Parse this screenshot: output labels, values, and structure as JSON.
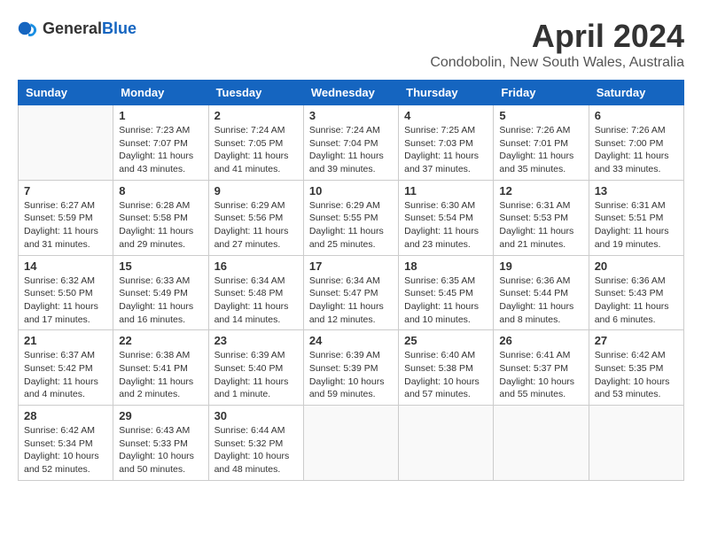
{
  "logo": {
    "text_general": "General",
    "text_blue": "Blue"
  },
  "title": "April 2024",
  "subtitle": "Condobolin, New South Wales, Australia",
  "days_of_week": [
    "Sunday",
    "Monday",
    "Tuesday",
    "Wednesday",
    "Thursday",
    "Friday",
    "Saturday"
  ],
  "weeks": [
    [
      {
        "day": "",
        "info": ""
      },
      {
        "day": "1",
        "info": "Sunrise: 7:23 AM\nSunset: 7:07 PM\nDaylight: 11 hours\nand 43 minutes."
      },
      {
        "day": "2",
        "info": "Sunrise: 7:24 AM\nSunset: 7:05 PM\nDaylight: 11 hours\nand 41 minutes."
      },
      {
        "day": "3",
        "info": "Sunrise: 7:24 AM\nSunset: 7:04 PM\nDaylight: 11 hours\nand 39 minutes."
      },
      {
        "day": "4",
        "info": "Sunrise: 7:25 AM\nSunset: 7:03 PM\nDaylight: 11 hours\nand 37 minutes."
      },
      {
        "day": "5",
        "info": "Sunrise: 7:26 AM\nSunset: 7:01 PM\nDaylight: 11 hours\nand 35 minutes."
      },
      {
        "day": "6",
        "info": "Sunrise: 7:26 AM\nSunset: 7:00 PM\nDaylight: 11 hours\nand 33 minutes."
      }
    ],
    [
      {
        "day": "7",
        "info": "Sunrise: 6:27 AM\nSunset: 5:59 PM\nDaylight: 11 hours\nand 31 minutes."
      },
      {
        "day": "8",
        "info": "Sunrise: 6:28 AM\nSunset: 5:58 PM\nDaylight: 11 hours\nand 29 minutes."
      },
      {
        "day": "9",
        "info": "Sunrise: 6:29 AM\nSunset: 5:56 PM\nDaylight: 11 hours\nand 27 minutes."
      },
      {
        "day": "10",
        "info": "Sunrise: 6:29 AM\nSunset: 5:55 PM\nDaylight: 11 hours\nand 25 minutes."
      },
      {
        "day": "11",
        "info": "Sunrise: 6:30 AM\nSunset: 5:54 PM\nDaylight: 11 hours\nand 23 minutes."
      },
      {
        "day": "12",
        "info": "Sunrise: 6:31 AM\nSunset: 5:53 PM\nDaylight: 11 hours\nand 21 minutes."
      },
      {
        "day": "13",
        "info": "Sunrise: 6:31 AM\nSunset: 5:51 PM\nDaylight: 11 hours\nand 19 minutes."
      }
    ],
    [
      {
        "day": "14",
        "info": "Sunrise: 6:32 AM\nSunset: 5:50 PM\nDaylight: 11 hours\nand 17 minutes."
      },
      {
        "day": "15",
        "info": "Sunrise: 6:33 AM\nSunset: 5:49 PM\nDaylight: 11 hours\nand 16 minutes."
      },
      {
        "day": "16",
        "info": "Sunrise: 6:34 AM\nSunset: 5:48 PM\nDaylight: 11 hours\nand 14 minutes."
      },
      {
        "day": "17",
        "info": "Sunrise: 6:34 AM\nSunset: 5:47 PM\nDaylight: 11 hours\nand 12 minutes."
      },
      {
        "day": "18",
        "info": "Sunrise: 6:35 AM\nSunset: 5:45 PM\nDaylight: 11 hours\nand 10 minutes."
      },
      {
        "day": "19",
        "info": "Sunrise: 6:36 AM\nSunset: 5:44 PM\nDaylight: 11 hours\nand 8 minutes."
      },
      {
        "day": "20",
        "info": "Sunrise: 6:36 AM\nSunset: 5:43 PM\nDaylight: 11 hours\nand 6 minutes."
      }
    ],
    [
      {
        "day": "21",
        "info": "Sunrise: 6:37 AM\nSunset: 5:42 PM\nDaylight: 11 hours\nand 4 minutes."
      },
      {
        "day": "22",
        "info": "Sunrise: 6:38 AM\nSunset: 5:41 PM\nDaylight: 11 hours\nand 2 minutes."
      },
      {
        "day": "23",
        "info": "Sunrise: 6:39 AM\nSunset: 5:40 PM\nDaylight: 11 hours\nand 1 minute."
      },
      {
        "day": "24",
        "info": "Sunrise: 6:39 AM\nSunset: 5:39 PM\nDaylight: 10 hours\nand 59 minutes."
      },
      {
        "day": "25",
        "info": "Sunrise: 6:40 AM\nSunset: 5:38 PM\nDaylight: 10 hours\nand 57 minutes."
      },
      {
        "day": "26",
        "info": "Sunrise: 6:41 AM\nSunset: 5:37 PM\nDaylight: 10 hours\nand 55 minutes."
      },
      {
        "day": "27",
        "info": "Sunrise: 6:42 AM\nSunset: 5:35 PM\nDaylight: 10 hours\nand 53 minutes."
      }
    ],
    [
      {
        "day": "28",
        "info": "Sunrise: 6:42 AM\nSunset: 5:34 PM\nDaylight: 10 hours\nand 52 minutes."
      },
      {
        "day": "29",
        "info": "Sunrise: 6:43 AM\nSunset: 5:33 PM\nDaylight: 10 hours\nand 50 minutes."
      },
      {
        "day": "30",
        "info": "Sunrise: 6:44 AM\nSunset: 5:32 PM\nDaylight: 10 hours\nand 48 minutes."
      },
      {
        "day": "",
        "info": ""
      },
      {
        "day": "",
        "info": ""
      },
      {
        "day": "",
        "info": ""
      },
      {
        "day": "",
        "info": ""
      }
    ]
  ]
}
